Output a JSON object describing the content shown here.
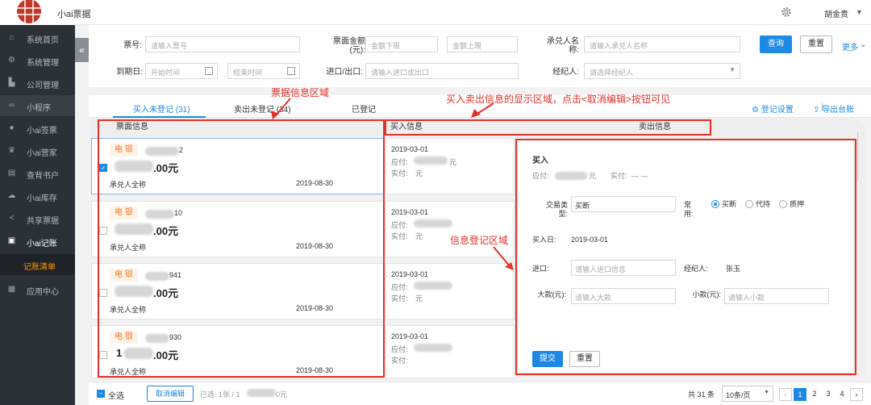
{
  "app": {
    "title": "小ai票据",
    "user": "胡金贵",
    "brand_color": "#c0392b"
  },
  "sidebar": {
    "items": [
      {
        "label": "系统首页",
        "icon": "home-icon"
      },
      {
        "label": "系统管理",
        "icon": "gear-icon"
      },
      {
        "label": "公司管理",
        "icon": "building-icon"
      },
      {
        "label": "小程序",
        "icon": "link-icon"
      },
      {
        "label": "小ai签票",
        "icon": "circle-icon"
      },
      {
        "label": "小ai营家",
        "icon": "trophy-icon"
      },
      {
        "label": "查背书户",
        "icon": "doc-icon"
      },
      {
        "label": "小ai库存",
        "icon": "cloud-icon"
      },
      {
        "label": "共享票据",
        "icon": "share-icon"
      },
      {
        "label": "小ai记账",
        "icon": "ledger-icon"
      },
      {
        "label": "记账清单",
        "icon": ""
      },
      {
        "label": "应用中心",
        "icon": "grid-icon"
      }
    ]
  },
  "filter": {
    "bill_no_label": "票号:",
    "bill_no_placeholder": "请输入票号",
    "amount_label": "票面金额(元):",
    "amount_min_placeholder": "金额下限",
    "amount_max_placeholder": "金额上限",
    "acceptor_label": "承兑人名称:",
    "acceptor_placeholder": "请输入承兑人名称",
    "query_button": "查询",
    "reset_button": "重置",
    "more_link": "更多",
    "due_label": "到期日:",
    "start_placeholder": "开始时间",
    "end_placeholder": "结束时间",
    "inout_label": "进口/出口:",
    "inout_placeholder": "请输入进口或出口",
    "broker_label": "经纪人:",
    "broker_placeholder": "请选择经纪人"
  },
  "tabs": {
    "items": [
      "买入未登记 (31)",
      "卖出未登记 (34)",
      "已登记"
    ],
    "settings": "登记设置",
    "export": "导出台账"
  },
  "columns": {
    "bill_info": "票面信息",
    "buy_info": "买入信息",
    "sell_info": "卖出信息"
  },
  "cards": [
    {
      "tag": "电 银",
      "no_suffix": "2",
      "amount_suffix": ".00元",
      "acceptor": "承兑人全称",
      "due": "2019-08-30"
    },
    {
      "tag": "电 银",
      "no_suffix": "10",
      "amount_suffix": ".00元",
      "acceptor": "承兑人全称",
      "due": "2019-08-30"
    },
    {
      "tag": "电 银",
      "no_suffix": "941",
      "amount_suffix": ".00元",
      "acceptor": "承兑人全称",
      "due": "2019-08-30"
    },
    {
      "tag": "电 银",
      "no_suffix": "930",
      "amount_prefix": "1",
      "amount_suffix": ".00元",
      "acceptor": "承兑人全称",
      "due": "2019-08-30"
    }
  ],
  "buy_rows": [
    {
      "date": "2019-03-01",
      "payable": "应付:",
      "payable_suffix": "元",
      "paid": "实付:",
      "paid_value": "元"
    },
    {
      "date": "2019-03-01",
      "payable": "应付:",
      "payable_suffix": "",
      "paid": "实付:",
      "paid_value": "元"
    },
    {
      "date": "2019-03-01",
      "payable": "应付:",
      "payable_suffix": "",
      "paid": "实付:",
      "paid_value": "元"
    },
    {
      "date": "2019-03-01",
      "payable": "应付:",
      "payable_suffix": "",
      "paid": "实付:",
      "paid_value": ""
    }
  ],
  "panel": {
    "title": "买入",
    "payable_label": "应付:",
    "payable_unit": "元",
    "paid_label": "实付:",
    "paid_value": "— —",
    "trade_type_label": "交易类型:",
    "trade_type_value": "买断",
    "common_label": "常用:",
    "radio_options": [
      "买断",
      "代持",
      "质押"
    ],
    "buy_date_label": "买入日:",
    "buy_date": "2019-03-01",
    "inlet_label": "进口:",
    "inlet_placeholder": "请输入进口信息",
    "broker_label": "经纪人:",
    "broker_value": "张玉",
    "big_label": "大款(元):",
    "big_placeholder": "请输入大款",
    "small_label": "小款(元):",
    "small_placeholder": "请输入小款",
    "submit": "提交",
    "reset": "重置"
  },
  "footer": {
    "select_all": "全选",
    "cancel_edit": "取消编辑",
    "selected_text": "已选: 1张 / 1",
    "selected_unit": "0元",
    "total": "共 31 条",
    "page_size": "10条/页",
    "pages": [
      "1",
      "2",
      "3",
      "4"
    ]
  },
  "annotations": {
    "bill_area": "票据信息区域",
    "buy_sell_area": "买入卖出信息的显示区域，点击<取消编辑>按钮可见",
    "register_area": "信息登记区域"
  }
}
